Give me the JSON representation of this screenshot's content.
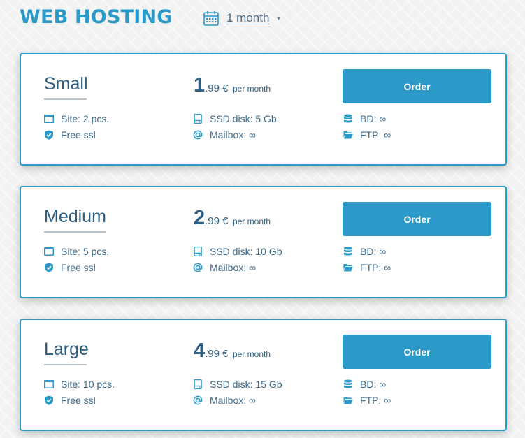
{
  "header": {
    "title": "WEB HOSTING",
    "period_label": "1 month"
  },
  "plans": [
    {
      "name": "Small",
      "price_int": "1",
      "price_dec": ".99 €",
      "price_per": "per month",
      "order_label": "Order",
      "site": "Site: 2 pcs.",
      "ssd": "SSD disk: 5 Gb",
      "bd": "BD: ∞",
      "ssl": "Free ssl",
      "mailbox": "Mailbox: ∞",
      "ftp": "FTP: ∞"
    },
    {
      "name": "Medium",
      "price_int": "2",
      "price_dec": ".99 €",
      "price_per": "per month",
      "order_label": "Order",
      "site": "Site: 5 pcs.",
      "ssd": "SSD disk: 10 Gb",
      "bd": "BD: ∞",
      "ssl": "Free ssl",
      "mailbox": "Mailbox: ∞",
      "ftp": "FTP: ∞"
    },
    {
      "name": "Large",
      "price_int": "4",
      "price_dec": ".99 €",
      "price_per": "per month",
      "order_label": "Order",
      "site": "Site: 10 pcs.",
      "ssd": "SSD disk: 15 Gb",
      "bd": "BD: ∞",
      "ssl": "Free ssl",
      "mailbox": "Mailbox: ∞",
      "ftp": "FTP: ∞"
    }
  ],
  "colors": {
    "accent": "#2b9ac9",
    "text": "#2e5f80",
    "feature_text": "#3d6a8a",
    "background": "#f2f2f2"
  },
  "icons": {
    "period": "calendar-icon",
    "site": "browser-window-icon",
    "ssd": "disk-icon",
    "bd": "database-icon",
    "ssl": "shield-check-icon",
    "mailbox": "at-sign-icon",
    "ftp": "folder-open-icon"
  }
}
